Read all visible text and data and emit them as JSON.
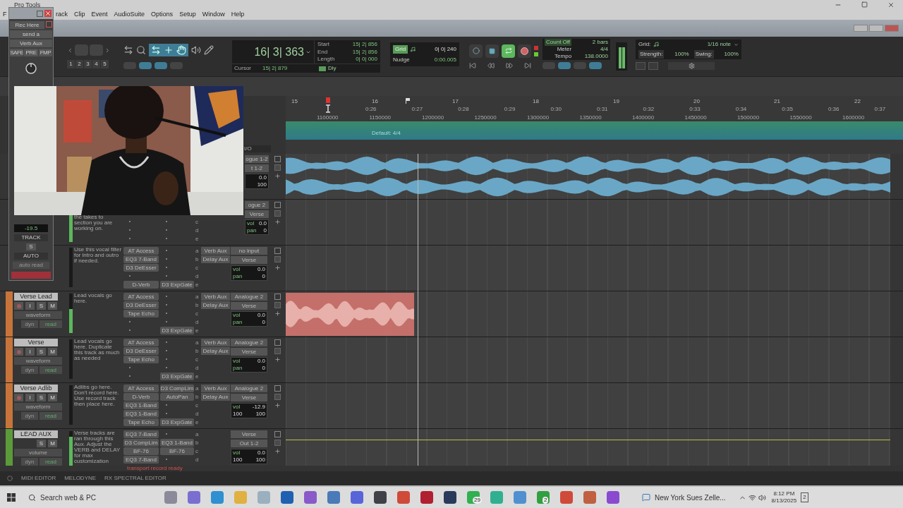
{
  "window": {
    "title": "Pro Tools"
  },
  "menu": [
    "F",
    "rack",
    "Clip",
    "Event",
    "AudioSuite",
    "Options",
    "Setup",
    "Window",
    "Help"
  ],
  "toolbar": {
    "zoom_presets": [
      "1",
      "2",
      "3",
      "4",
      "5"
    ],
    "counter": {
      "main": "16| 3| 363",
      "start_label": "Start",
      "start": "15| 2| 856",
      "end_label": "End",
      "end": "15| 2| 856",
      "length_label": "Length",
      "length": "0| 0| 000",
      "cursor_label": "Cursor",
      "cursor": "15| 2| 879",
      "delay": "Dly"
    },
    "grid_nudge": {
      "grid": "Grid",
      "grid_value": "0| 0| 240",
      "nudge": "Nudge",
      "nudge_value": "0:00.005"
    },
    "transport": [
      {
        "kind": "online",
        "selected": false
      },
      {
        "kind": "stop",
        "selected": false
      },
      {
        "kind": "play",
        "selected": true
      },
      {
        "kind": "record",
        "selected": false
      }
    ],
    "tempo": {
      "count_off": "Count Off",
      "bars": "2 bars",
      "meter_label": "Meter",
      "meter": "4/4",
      "tempo_label": "Tempo",
      "tempo": "138.0000"
    },
    "grid_panel": {
      "grid_label": "Grid:",
      "grid": "1/16 note",
      "strength_label": "Strength:",
      "strength": "100%",
      "swing_label": "Swing:",
      "swing": "100%"
    }
  },
  "send_window": {
    "track": "Rec Here",
    "send": "send a",
    "destination": "Verb Aux",
    "buttons": [
      "SAFE",
      "PRE",
      "FMP"
    ],
    "level": "-19.5",
    "track_label": "TRACK",
    "solo": "S",
    "auto_label": "AUTO",
    "automation": "auto read"
  },
  "ruler": {
    "bars": [
      "15",
      "16",
      "17",
      "18",
      "19",
      "20",
      "21",
      "22"
    ],
    "times": [
      "0:26",
      "0:27",
      "0:28",
      "0:29",
      "0:30",
      "0:31",
      "0:32",
      "0:33",
      "0:34",
      "0:35",
      "0:36",
      "0:37"
    ],
    "samples": [
      "1100000",
      "1150000",
      "1200000",
      "1250000",
      "1300000",
      "1350000",
      "1400000",
      "1450000",
      "1500000",
      "1550000",
      "1600000"
    ],
    "meter_marker": "Default: 4/4"
  },
  "io_header": "I/O",
  "tracks": [
    {
      "kind": "under_video",
      "io": {
        "input": "ogue 1-2",
        "output": "t 1-2"
      },
      "vol": "0.0",
      "pan": [
        "100"
      ],
      "region": {
        "kind": "long",
        "color": "#6aa7c6"
      }
    },
    {
      "kind": "under_video",
      "meter": {
        "level": 0.95
      },
      "comment": "the takes to section you are working on.",
      "inserts": [
        {
          "kind": "empty"
        },
        {
          "kind": "empty"
        },
        {
          "kind": "empty"
        },
        {
          "kind": "empty"
        },
        {
          "kind": "empty"
        }
      ],
      "inserts2": [
        {
          "kind": "empty"
        },
        {
          "kind": "empty"
        },
        {
          "kind": "empty"
        },
        {
          "kind": "empty"
        },
        {
          "kind": "empty"
        }
      ],
      "sends": [
        {
          "kind": "empty"
        },
        {
          "kind": "empty"
        },
        {
          "kind": "letter",
          "letter": "c"
        },
        {
          "kind": "letter",
          "letter": "d"
        },
        {
          "kind": "letter",
          "letter": "e"
        }
      ],
      "io": {
        "input": "ogue 2",
        "output": "Verse"
      },
      "vol_label": "vol",
      "vol": "0.0",
      "pan_label": "pan",
      "pan": [
        "0"
      ]
    },
    {
      "kind": "under_window",
      "comment": "Use this vocal filter for intro and outro if needed.",
      "inserts": [
        {
          "kind": "plugin",
          "name": "AT Access"
        },
        {
          "kind": "plugin",
          "name": "EQ3 7-Band"
        },
        {
          "kind": "plugin",
          "name": "D3 DeEsser"
        },
        {
          "kind": "empty"
        },
        {
          "kind": "plugin",
          "name": "D-Verb"
        }
      ],
      "inserts2": [
        {
          "kind": "empty"
        },
        {
          "kind": "empty"
        },
        {
          "kind": "empty"
        },
        {
          "kind": "empty"
        },
        {
          "kind": "plugin",
          "name": "D3 ExpGate"
        }
      ],
      "sends": [
        {
          "kind": "send",
          "letter": "a",
          "name": "Verb Aux"
        },
        {
          "kind": "send",
          "letter": "b",
          "name": "Delay Aux"
        },
        {
          "kind": "letter",
          "letter": "c"
        },
        {
          "kind": "letter",
          "letter": "d"
        },
        {
          "kind": "letter",
          "letter": "e"
        }
      ],
      "io": {
        "input": "no input",
        "output": "Verse"
      },
      "vol_label": "vol",
      "vol": "0.0",
      "pan_label": "pan",
      "pan": [
        "0"
      ]
    },
    {
      "kind": "full",
      "name": "Verse Lead",
      "color": "#c7743a",
      "record": true,
      "buttons": [
        "I",
        "S",
        "M"
      ],
      "view": "waveform",
      "dyn": "dyn",
      "auto": "read",
      "meter": {
        "level": 0.6
      },
      "comment": "Lead vocals go here.",
      "inserts": [
        {
          "kind": "plugin",
          "name": "AT Access"
        },
        {
          "kind": "plugin",
          "name": "D3 DeEsser"
        },
        {
          "kind": "plugin",
          "name": "Tape Echo"
        },
        {
          "kind": "empty"
        },
        {
          "kind": "empty"
        }
      ],
      "inserts2": [
        {
          "kind": "empty"
        },
        {
          "kind": "empty"
        },
        {
          "kind": "empty"
        },
        {
          "kind": "empty"
        },
        {
          "kind": "plugin",
          "name": "D3 ExpGate"
        }
      ],
      "sends": [
        {
          "kind": "send",
          "letter": "a",
          "name": "Verb Aux"
        },
        {
          "kind": "send",
          "letter": "b",
          "name": "Delay Aux"
        },
        {
          "kind": "letter",
          "letter": "c"
        },
        {
          "kind": "letter",
          "letter": "d"
        },
        {
          "kind": "letter",
          "letter": "e"
        }
      ],
      "io": {
        "input": "Analogue 2",
        "output": "Verse"
      },
      "vol_label": "vol",
      "vol": "0.0",
      "pan_label": "pan",
      "pan": [
        "0"
      ],
      "region": {
        "kind": "short",
        "color": "#c46f6a"
      }
    },
    {
      "kind": "full",
      "name": "Verse",
      "color": "#c7743a",
      "record": true,
      "buttons": [
        "I",
        "S",
        "M"
      ],
      "view": "waveform",
      "dyn": "dyn",
      "auto": "read",
      "comment": "Lead vocals go here. Duplicate this track as much as needed",
      "inserts": [
        {
          "kind": "plugin",
          "name": "AT Access"
        },
        {
          "kind": "plugin",
          "name": "D3 DeEsser"
        },
        {
          "kind": "plugin",
          "name": "Tape Echo"
        },
        {
          "kind": "empty"
        },
        {
          "kind": "empty"
        }
      ],
      "inserts2": [
        {
          "kind": "empty"
        },
        {
          "kind": "empty"
        },
        {
          "kind": "empty"
        },
        {
          "kind": "empty"
        },
        {
          "kind": "plugin",
          "name": "D3 ExpGate"
        }
      ],
      "sends": [
        {
          "kind": "send",
          "letter": "a",
          "name": "Verb Aux"
        },
        {
          "kind": "send",
          "letter": "b",
          "name": "Delay Aux"
        },
        {
          "kind": "letter",
          "letter": "c"
        },
        {
          "kind": "letter",
          "letter": "d"
        },
        {
          "kind": "letter",
          "letter": "e"
        }
      ],
      "io": {
        "input": "Analogue 2",
        "output": "Verse"
      },
      "vol_label": "vol",
      "vol": "0.0",
      "pan_label": "pan",
      "pan": [
        "0"
      ]
    },
    {
      "kind": "full",
      "name": "Verse Adlib",
      "color": "#c7743a",
      "record": true,
      "buttons": [
        "I",
        "S",
        "M"
      ],
      "view": "waveform",
      "dyn": "dyn",
      "auto": "read",
      "comment": "Adlibs go here. Don't record here. Use record track then place here.",
      "inserts": [
        {
          "kind": "plugin",
          "name": "AT Access"
        },
        {
          "kind": "plugin",
          "name": "D-Verb"
        },
        {
          "kind": "plugin",
          "name": "EQ3 1-Band"
        },
        {
          "kind": "plugin",
          "name": "EQ3 1-Band"
        },
        {
          "kind": "plugin",
          "name": "Tape Echo"
        }
      ],
      "inserts2": [
        {
          "kind": "plugin",
          "name": "D3 CompLim"
        },
        {
          "kind": "plugin",
          "name": "AutoPan"
        },
        {
          "kind": "empty"
        },
        {
          "kind": "empty"
        },
        {
          "kind": "plugin",
          "name": "D3 ExpGate"
        }
      ],
      "sends": [
        {
          "kind": "send",
          "letter": "a",
          "name": "Verb Aux"
        },
        {
          "kind": "send",
          "letter": "b",
          "name": "Delay Aux"
        },
        {
          "kind": "letter",
          "letter": "c"
        },
        {
          "kind": "letter",
          "letter": "d"
        },
        {
          "kind": "letter",
          "letter": "e"
        }
      ],
      "io": {
        "input": "Analogue 2",
        "output": "Verse"
      },
      "vol_label": "vol",
      "vol": "-12.9",
      "pan": [
        "100",
        "100"
      ]
    },
    {
      "kind": "full",
      "name": "LEAD AUX",
      "color": "#5a9a3a",
      "record": false,
      "buttons": [
        "S",
        "M"
      ],
      "view": "volume",
      "dyn": "dyn",
      "auto": "read",
      "meter": {
        "level": 0.85
      },
      "comment": "Verse tracks are ran through this Aux. Adjust the VERB and DELAY for max customization",
      "inserts": [
        {
          "kind": "plugin",
          "name": "EQ3 7-Band"
        },
        {
          "kind": "plugin",
          "name": "D3 CompLim"
        },
        {
          "kind": "plugin",
          "name": "BF-76"
        },
        {
          "kind": "plugin",
          "name": "EQ3 7-Band"
        }
      ],
      "inserts2": [
        {
          "kind": "empty"
        },
        {
          "kind": "plugin",
          "name": "EQ3 1-Band"
        },
        {
          "kind": "plugin",
          "name": "BF-76"
        },
        {
          "kind": "empty"
        }
      ],
      "sends": [
        {
          "kind": "letter",
          "letter": "a"
        },
        {
          "kind": "letter",
          "letter": "b"
        },
        {
          "kind": "letter",
          "letter": "c"
        },
        {
          "kind": "letter",
          "letter": "d"
        }
      ],
      "io": {
        "input": "Verse",
        "output": "Out 1-2"
      },
      "vol_label": "vol",
      "vol": "0.0",
      "pan": [
        "100",
        "100"
      ],
      "automation_line": true
    }
  ],
  "status": "transport record ready",
  "bottom_tabs": [
    "MIDI EDITOR",
    "MELODYNE",
    "RX SPECTRAL EDITOR"
  ],
  "taskbar": {
    "search": "Search web & PC",
    "apps": [
      {
        "color": "#8a8a9a"
      },
      {
        "color": "#7a6fd0"
      },
      {
        "color": "#2f8fd0"
      },
      {
        "color": "#e0b040"
      },
      {
        "color": "#9ab0c0"
      },
      {
        "color": "#2060b0"
      },
      {
        "color": "#8a5ac8"
      },
      {
        "color": "#4a7ab8"
      },
      {
        "color": "#5865d8"
      },
      {
        "color": "#404048"
      },
      {
        "color": "#d04a3a"
      },
      {
        "color": "#b02030"
      },
      {
        "color": "#2a3a5a"
      },
      {
        "color": "#30b050",
        "badge": "29"
      },
      {
        "color": "#30b090"
      },
      {
        "color": "#5090d0"
      },
      {
        "color": "#30a040",
        "badge": "2"
      },
      {
        "color": "#d04a3a"
      },
      {
        "color": "#c06040"
      },
      {
        "color": "#8a4ad0"
      }
    ],
    "news": "New York Sues Zelle...",
    "time": "8:12 PM",
    "date": "8/13/2025",
    "notifications": "2"
  }
}
